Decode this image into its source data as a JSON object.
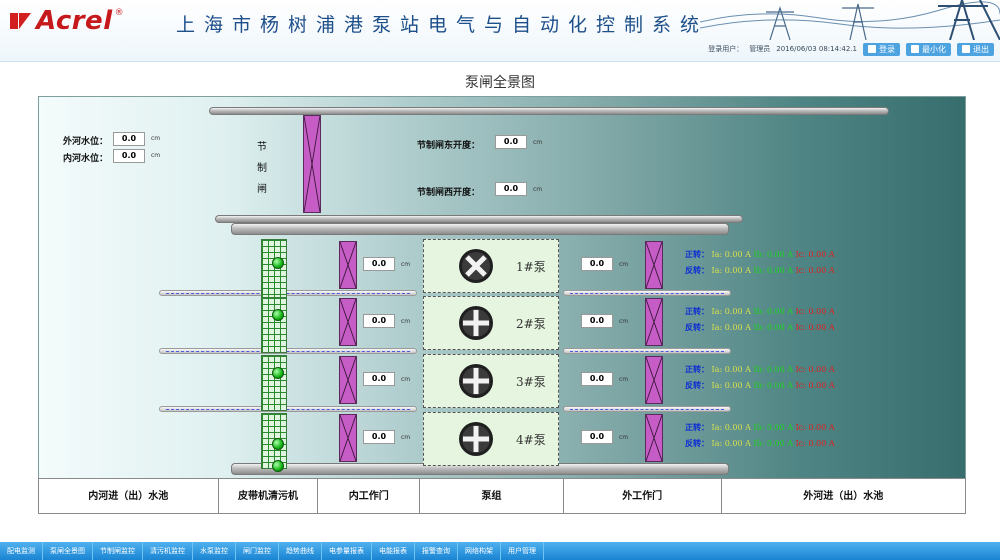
{
  "header": {
    "logo_text": "Acrel",
    "logo_mark": "®",
    "system_title": "上海市杨树浦港泵站电气与自动化控制系统",
    "user_label": "登录用户：",
    "user_name": "管理员",
    "datetime": "2016/06/03  08:14:42.1",
    "login_label": "登录",
    "minimize_label": "最小化",
    "exit_label": "退出",
    "accent_color": "#1d4f8a",
    "brand_color": "#c6191b"
  },
  "page_title": "泵闸全景图",
  "water_levels": {
    "outer_label": "外河水位：",
    "outer_value": "0.0",
    "inner_label": "内河水位：",
    "inner_value": "0.0",
    "unit": "cm"
  },
  "control_gate": {
    "label": "节制闸",
    "east_label": "节制闸东开度：",
    "east_value": "0.0",
    "west_label": "节制闸西开度：",
    "west_value": "0.0",
    "unit": "cm"
  },
  "pumps": [
    {
      "name": "1#泵",
      "inner_gate_value": "0.0",
      "outer_gate_value": "0.0",
      "unit": "cm",
      "forward_label": "正转：",
      "reverse_label": "反转：",
      "ia": "Ia: 0.00 A",
      "ib": "Ib: 0.00 A",
      "ic": "Ic: 0.00 A"
    },
    {
      "name": "2#泵",
      "inner_gate_value": "0.0",
      "outer_gate_value": "0.0",
      "unit": "cm",
      "forward_label": "正转：",
      "reverse_label": "反转：",
      "ia": "Ia: 0.00 A",
      "ib": "Ib: 0.00 A",
      "ic": "Ic: 0.00 A"
    },
    {
      "name": "3#泵",
      "inner_gate_value": "0.0",
      "outer_gate_value": "0.0",
      "unit": "cm",
      "forward_label": "正转：",
      "reverse_label": "反转：",
      "ia": "Ia: 0.00 A",
      "ib": "Ib: 0.00 A",
      "ic": "Ic: 0.00 A"
    },
    {
      "name": "4#泵",
      "inner_gate_value": "0.0",
      "outer_gate_value": "0.0",
      "unit": "cm",
      "forward_label": "正转：",
      "reverse_label": "反转：",
      "ia": "Ia: 0.00 A",
      "ib": "Ib: 0.00 A",
      "ic": "Ic: 0.00 A"
    }
  ],
  "bottom_labels": [
    "内河进（出）水池",
    "皮带机清污机",
    "内工作门",
    "泵组",
    "外工作门",
    "外河进（出）水池"
  ],
  "nav": [
    "配电监测",
    "泵闸全景图",
    "节制闸监控",
    "清污机监控",
    "水泵监控",
    "闸门监控",
    "趋势曲线",
    "电参量报表",
    "电能报表",
    "报警查询",
    "网络构架",
    "用户管理"
  ],
  "colors": {
    "status_green": "#13b313",
    "gate_purple": "#c65cc6",
    "nav_blue": "#1a84d3",
    "current_a": "#d8e14a",
    "current_b": "#1ed41e",
    "current_c": "#e02020"
  }
}
